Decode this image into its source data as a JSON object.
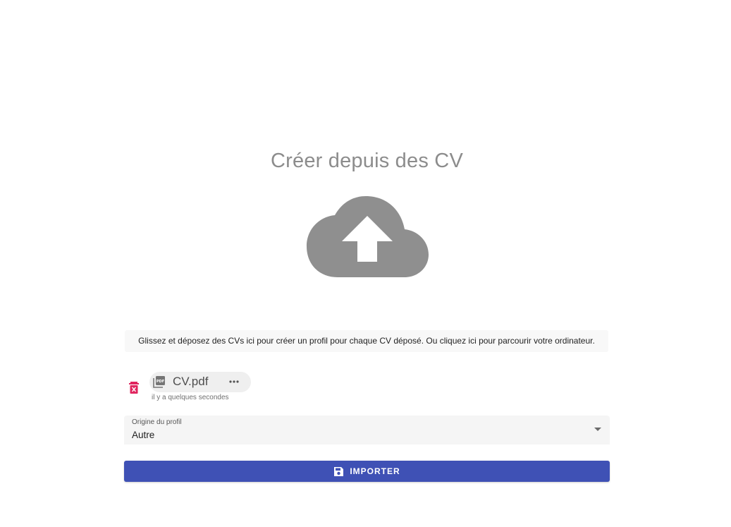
{
  "page": {
    "title": "Créer depuis des CV"
  },
  "upload": {
    "icon": "cloud-upload-icon",
    "hint": "Glissez et déposez des CVs ici pour créer un profil pour chaque CV déposé. Ou cliquez ici pour parcourir votre ordinateur."
  },
  "file": {
    "name": "CV.pdf",
    "time": "il y a quelques secondes",
    "icon": "pdf-file-icon",
    "delete_icon": "delete-icon",
    "more_icon": "more-horizontal-icon",
    "delete_color": "#e0245e"
  },
  "origin": {
    "label": "Origine du profil",
    "value": "Autre"
  },
  "import_button": {
    "label": "IMPORTER",
    "icon": "save-icon",
    "color": "#3f51b5"
  }
}
